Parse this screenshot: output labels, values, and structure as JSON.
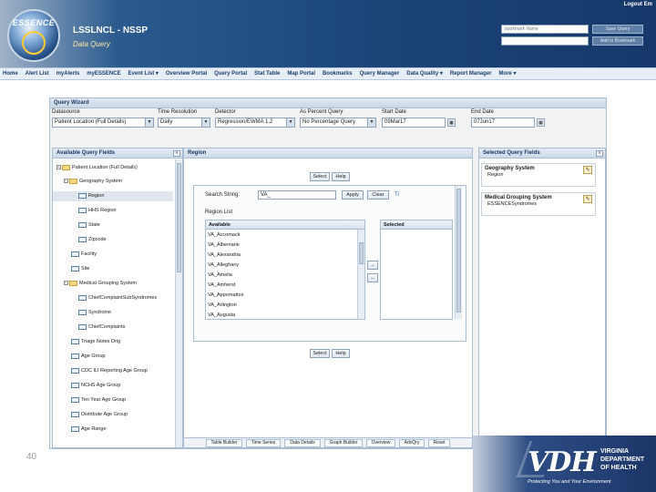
{
  "header": {
    "logo_text": "ESSENCE",
    "title": "LSSLNCL - NSSP",
    "subtitle": "Data Query",
    "logout": "Logout Em",
    "bookmark_placeholder": "bookmark Name",
    "btn1": "Save Query",
    "btn2": "Add to Bookmark"
  },
  "nav": [
    "Home",
    "Alert List",
    "myAlerts",
    "myESSENCE",
    "Event List ▾",
    "Overview Portal",
    "Query Portal",
    "Stat Table",
    "Map Portal",
    "Bookmarks",
    "Query Manager",
    "Data Quality ▾",
    "Report Manager",
    "More ▾"
  ],
  "wizard": {
    "title": "Query Wizard",
    "fields": {
      "datasource": {
        "label": "Datasource",
        "value": "Patient Location (Full Details)"
      },
      "time_resolution": {
        "label": "Time Resolution",
        "value": "Daily"
      },
      "detector": {
        "label": "Detector",
        "value": "Regression/EWMA 1.2"
      },
      "percent_query": {
        "label": "As Percent Query",
        "value": "No Percentage Query"
      },
      "start_date": {
        "label": "Start Date",
        "value": "09Mar17"
      },
      "end_date": {
        "label": "End Date",
        "value": "07Jun17"
      }
    },
    "available_fields": {
      "title": "Available Query Fields",
      "items": [
        {
          "label": "Patient Location (Full Details)"
        },
        {
          "label": "Geography System"
        },
        {
          "label": "Region"
        },
        {
          "label": "HHS Region"
        },
        {
          "label": "State"
        },
        {
          "label": "Zipcode"
        },
        {
          "label": "Facility"
        },
        {
          "label": "Site"
        },
        {
          "label": "Medical Grouping System"
        },
        {
          "label": "ChiefComplaintSubSyndromes"
        },
        {
          "label": "Syndrome"
        },
        {
          "label": "ChiefComplaints"
        },
        {
          "label": "Triage Notes Orig"
        },
        {
          "label": "Age Group"
        },
        {
          "label": "CDC ILI Reporting Age Group"
        },
        {
          "label": "NCHS Age Group"
        },
        {
          "label": "Ten Year Age Group"
        },
        {
          "label": "Distribute Age Group"
        },
        {
          "label": "Age Range"
        }
      ]
    },
    "region": {
      "title": "Region",
      "select_label": "Select",
      "help_label": "Help",
      "search_label": "Search String:",
      "search_value": "VA_",
      "apply_label": "Apply",
      "clear_label": "Clear",
      "tip": "Ti",
      "region_list_label": "Region List",
      "available_head": "Available",
      "selected_head": "Selected",
      "regions": [
        "VA_Accomack",
        "VA_Albemarle",
        "VA_Alexandria",
        "VA_Alleghany",
        "VA_Amelia",
        "VA_Amherst",
        "VA_Appomattox",
        "VA_Arlington",
        "VA_Augusta"
      ],
      "add_arrow": "→",
      "remove_arrow": "←"
    },
    "selected_fields": {
      "title": "Selected Query Fields",
      "items": [
        {
          "title": "Geography System",
          "value": "Region"
        },
        {
          "title": "Medical Grouping System",
          "value": "ESSENCESyndromes"
        }
      ]
    },
    "tabs": [
      "Table Builder",
      "Time Series",
      "Data Details",
      "Graph Builder",
      "Overview",
      "AdvQry",
      "Reset"
    ]
  },
  "footer": {
    "page_number": "40",
    "vdh": "VDH",
    "line1": "VIRGINIA",
    "line2": "DEPARTMENT",
    "line3": "OF HEALTH",
    "tagline": "Protecting You and Your Environment"
  }
}
